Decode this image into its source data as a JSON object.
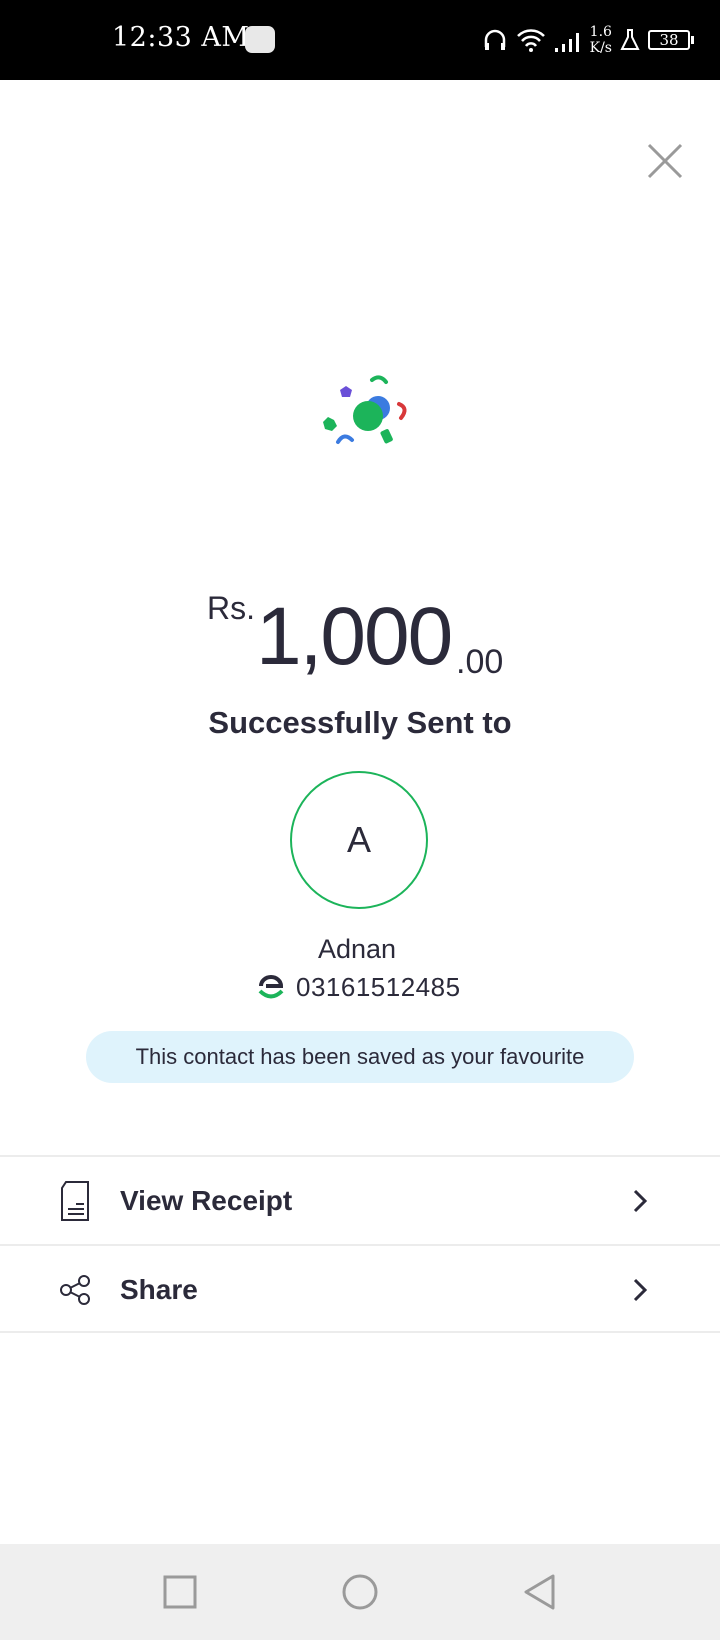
{
  "status_bar": {
    "time": "12:33 AM",
    "net_speed_value": "1.6",
    "net_speed_unit": "K/s",
    "battery": "38"
  },
  "amount": {
    "currency": "Rs.",
    "major": "1,000",
    "minor": ".00"
  },
  "status_message": "Successfully Sent to",
  "recipient": {
    "initial": "A",
    "name": "Adnan",
    "number": "03161512485"
  },
  "favourite_notice": "This contact has been saved as your favourite",
  "actions": [
    {
      "label": "View Receipt",
      "icon": "receipt-icon"
    },
    {
      "label": "Share",
      "icon": "share-icon"
    }
  ],
  "colors": {
    "accent_green": "#1cb45a",
    "text_dark": "#2b2a3a",
    "notice_bg": "#dff3fc"
  }
}
